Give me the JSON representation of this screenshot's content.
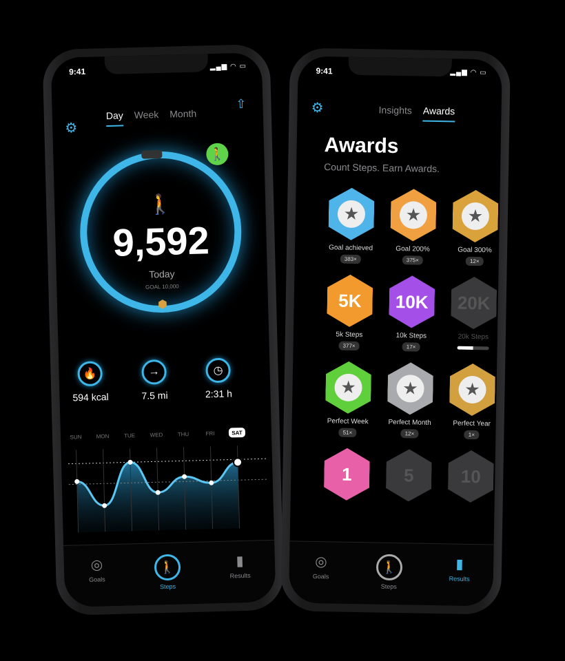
{
  "left_phone": {
    "status_time": "9:41",
    "tabs": [
      "Day",
      "Week",
      "Month"
    ],
    "active_tab": "Day",
    "steps": "9,592",
    "today_label": "Today",
    "goal_label": "GOAL 10,000",
    "goal_progress": 0.96,
    "stats": [
      {
        "icon": "flame-icon",
        "glyph": "🔥",
        "value": "594 kcal"
      },
      {
        "icon": "arrow-right-icon",
        "glyph": "→",
        "value": "7.5 mi"
      },
      {
        "icon": "clock-icon",
        "glyph": "◷",
        "value": "2:31 h"
      }
    ],
    "chart_data": {
      "type": "area",
      "categories": [
        "SUN",
        "MON",
        "TUE",
        "WED",
        "THU",
        "FRI",
        "SAT"
      ],
      "selected": "SAT",
      "values": [
        7400,
        3800,
        10000,
        5500,
        7700,
        6700,
        9592
      ]
    },
    "nav": [
      {
        "label": "Goals",
        "icon": "target-icon",
        "glyph": "◎"
      },
      {
        "label": "Steps",
        "icon": "walking-icon",
        "glyph": "🚶"
      },
      {
        "label": "Results",
        "icon": "bar-chart-icon",
        "glyph": "▮"
      }
    ],
    "active_nav": "Steps",
    "accent": "#3fb6e8"
  },
  "right_phone": {
    "status_time": "9:41",
    "tabs": [
      "Insights",
      "Awards"
    ],
    "active_tab": "Awards",
    "title": "Awards",
    "subtitle": "Count Steps. Earn Awards.",
    "awards": [
      {
        "name": "Goal achieved",
        "count": "383×",
        "color": "#4fb4ea",
        "glyph": "★"
      },
      {
        "name": "Goal 200%",
        "count": "375×",
        "color": "#f0a040",
        "glyph": "★"
      },
      {
        "name": "Goal 300%",
        "count": "12×",
        "color": "#d9a23a",
        "glyph": "★"
      },
      {
        "name": "5k Steps",
        "count": "377×",
        "color": "#f39a2e",
        "glyph": "5K"
      },
      {
        "name": "10k Steps",
        "count": "17×",
        "color": "#a44fe8",
        "glyph": "10K"
      },
      {
        "name": "20k Steps",
        "progress": 0.5,
        "color": "#3a3a3c",
        "glyph": "20K",
        "locked": true
      },
      {
        "name": "Perfect Week",
        "count": "51×",
        "color": "#5fcf3c",
        "glyph": "★"
      },
      {
        "name": "Perfect Month",
        "count": "12×",
        "color": "#a9aaae",
        "glyph": "★"
      },
      {
        "name": "Perfect Year",
        "count": "1×",
        "color": "#d3a040",
        "glyph": "★"
      },
      {
        "color": "#e860a8",
        "glyph": "1"
      },
      {
        "color": "#3a3a3c",
        "glyph": "5",
        "locked": true
      },
      {
        "color": "#3a3a3c",
        "glyph": "10",
        "locked": true
      }
    ],
    "nav": [
      {
        "label": "Goals",
        "icon": "target-icon",
        "glyph": "◎"
      },
      {
        "label": "Steps",
        "icon": "walking-icon",
        "glyph": "🚶"
      },
      {
        "label": "Results",
        "icon": "bar-chart-icon",
        "glyph": "▮▮"
      }
    ],
    "active_nav": "Results"
  }
}
